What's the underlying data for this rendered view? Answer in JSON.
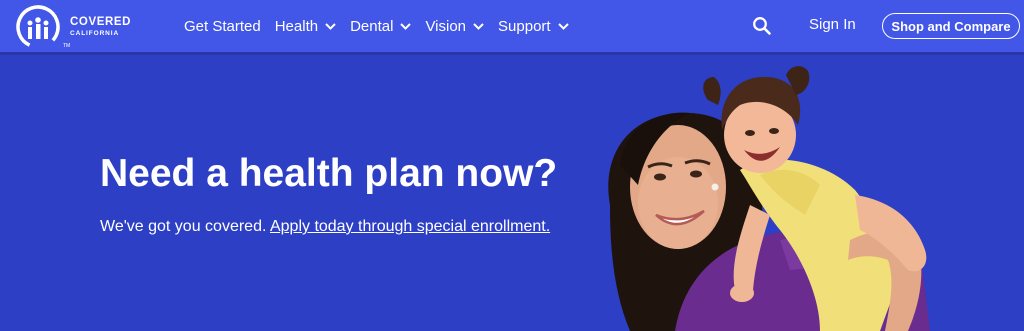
{
  "logo": {
    "name": "COVERED",
    "sub": "CALIFORNIA",
    "tm": "TM"
  },
  "nav": {
    "items": [
      {
        "label": "Get Started",
        "has_dropdown": false
      },
      {
        "label": "Health",
        "has_dropdown": true
      },
      {
        "label": "Dental",
        "has_dropdown": true
      },
      {
        "label": "Vision",
        "has_dropdown": true
      },
      {
        "label": "Support",
        "has_dropdown": true
      }
    ],
    "search_icon": "search-icon",
    "signin_label": "Sign In",
    "shop_label": "Shop and Compare"
  },
  "hero": {
    "heading": "Need a health plan now?",
    "sub_text": "We've got you covered.",
    "link_text": "Apply today through special enrollment.",
    "image": "Smiling woman carrying a laughing toddler on her back"
  },
  "colors": {
    "header_bg": "#4256e8",
    "hero_bg": "#2d3fc4",
    "text": "#ffffff"
  }
}
